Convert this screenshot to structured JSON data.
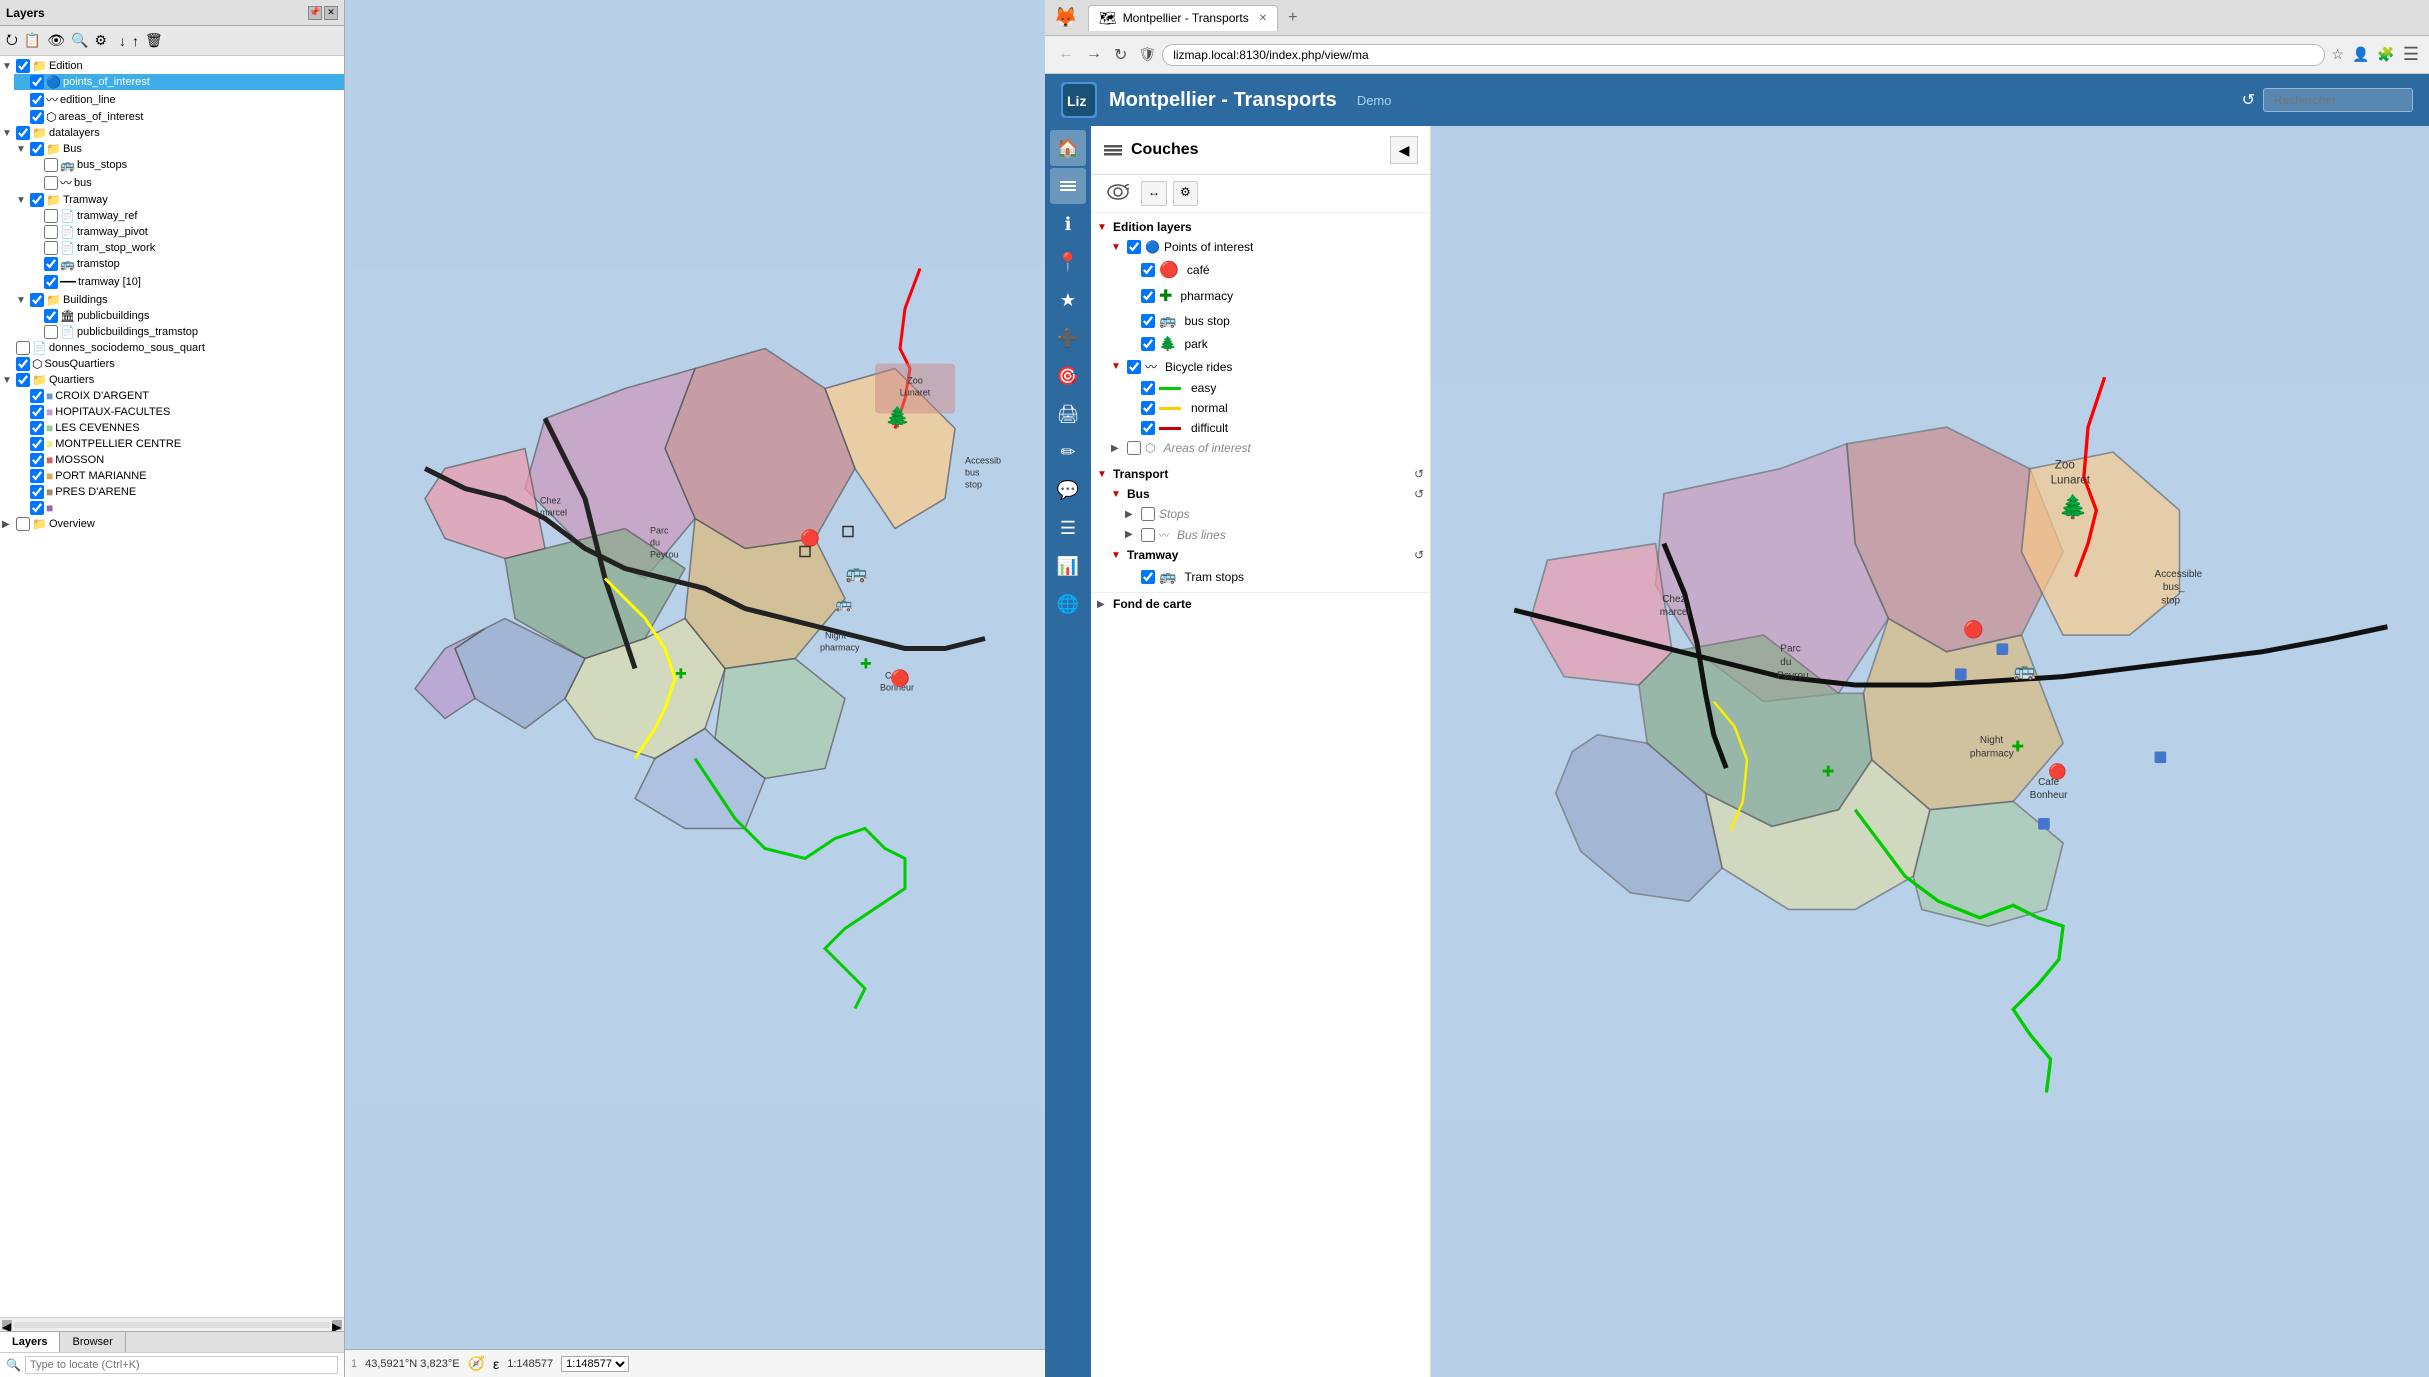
{
  "qgis": {
    "title": "Layers",
    "toolbar_icons": [
      "⭮",
      "📋",
      "👁",
      "🔍",
      "⚙",
      "↓",
      "↑",
      "🗑"
    ],
    "layers": [
      {
        "id": "edition",
        "label": "Edition",
        "level": 0,
        "expand": true,
        "checked": true,
        "icon": "📁",
        "selected": false
      },
      {
        "id": "points_of_interest",
        "label": "points_of_interest",
        "level": 1,
        "expand": false,
        "checked": true,
        "icon": "🔵",
        "selected": true
      },
      {
        "id": "edition_line",
        "label": "edition_line",
        "level": 1,
        "expand": false,
        "checked": true,
        "icon": "〰",
        "selected": false
      },
      {
        "id": "areas_of_interest",
        "label": "areas_of_interest",
        "level": 1,
        "expand": false,
        "checked": true,
        "icon": "⬡",
        "selected": false
      },
      {
        "id": "datalayers",
        "label": "datalayers",
        "level": 0,
        "expand": true,
        "checked": true,
        "icon": "📁",
        "selected": false
      },
      {
        "id": "bus_group",
        "label": "Bus",
        "level": 1,
        "expand": true,
        "checked": true,
        "icon": "📁",
        "selected": false
      },
      {
        "id": "bus_stops",
        "label": "bus_stops",
        "level": 2,
        "expand": false,
        "checked": false,
        "icon": "🚌",
        "selected": false
      },
      {
        "id": "bus",
        "label": "bus",
        "level": 2,
        "expand": false,
        "checked": false,
        "icon": "〰",
        "selected": false
      },
      {
        "id": "tramway_group",
        "label": "Tramway",
        "level": 1,
        "expand": true,
        "checked": true,
        "icon": "📁",
        "selected": false
      },
      {
        "id": "tramway_ref",
        "label": "tramway_ref",
        "level": 2,
        "expand": false,
        "checked": false,
        "icon": "📄",
        "selected": false
      },
      {
        "id": "tramway_pivot",
        "label": "tramway_pivot",
        "level": 2,
        "expand": false,
        "checked": false,
        "icon": "📄",
        "selected": false
      },
      {
        "id": "tram_stop_work",
        "label": "tram_stop_work",
        "level": 2,
        "expand": false,
        "checked": false,
        "icon": "📄",
        "selected": false
      },
      {
        "id": "tramstop",
        "label": "tramstop",
        "level": 2,
        "expand": false,
        "checked": true,
        "icon": "🚌",
        "selected": false
      },
      {
        "id": "tramway",
        "label": "tramway [10]",
        "level": 2,
        "expand": false,
        "checked": true,
        "icon": "—",
        "selected": false
      },
      {
        "id": "buildings_group",
        "label": "Buildings",
        "level": 1,
        "expand": true,
        "checked": true,
        "icon": "📁",
        "selected": false
      },
      {
        "id": "publicbuildings",
        "label": "publicbuildings",
        "level": 2,
        "expand": false,
        "checked": true,
        "icon": "🏛",
        "selected": false
      },
      {
        "id": "publicbuildings_tramstop",
        "label": "publicbuildings_tramstop",
        "level": 2,
        "expand": false,
        "checked": false,
        "icon": "📄",
        "selected": false
      },
      {
        "id": "donnes",
        "label": "donnes_sociodemo_sous_quart",
        "level": 0,
        "expand": false,
        "checked": false,
        "icon": "📄",
        "selected": false
      },
      {
        "id": "sousquartiers",
        "label": "SousQuartiers",
        "level": 0,
        "expand": false,
        "checked": true,
        "icon": "⬡",
        "selected": false
      },
      {
        "id": "quartiers",
        "label": "Quartiers",
        "level": 0,
        "expand": true,
        "checked": true,
        "icon": "📁",
        "selected": false
      },
      {
        "id": "croix",
        "label": "CROIX D'ARGENT",
        "level": 1,
        "expand": false,
        "checked": true,
        "icon": "🟦",
        "selected": false
      },
      {
        "id": "hopitaux",
        "label": "HOPITAUX-FACULTES",
        "level": 1,
        "expand": false,
        "checked": true,
        "icon": "🟪",
        "selected": false
      },
      {
        "id": "cevennes",
        "label": "LES CEVENNES",
        "level": 1,
        "expand": false,
        "checked": true,
        "icon": "🟩",
        "selected": false
      },
      {
        "id": "montpellier_centre",
        "label": "MONTPELLIER CENTRE",
        "level": 1,
        "expand": false,
        "checked": true,
        "icon": "🟨",
        "selected": false
      },
      {
        "id": "mosson",
        "label": "MOSSON",
        "level": 1,
        "expand": false,
        "checked": true,
        "icon": "🟥",
        "selected": false
      },
      {
        "id": "port_marianne",
        "label": "PORT MARIANNE",
        "level": 1,
        "expand": false,
        "checked": true,
        "icon": "🟧",
        "selected": false
      },
      {
        "id": "pres_arene",
        "label": "PRES D'ARENE",
        "level": 1,
        "expand": false,
        "checked": true,
        "icon": "🟫",
        "selected": false
      },
      {
        "id": "pres_arene2",
        "label": "",
        "level": 1,
        "expand": false,
        "checked": true,
        "icon": "🟪",
        "selected": false
      },
      {
        "id": "overview",
        "label": "Overview",
        "level": 0,
        "expand": false,
        "checked": false,
        "icon": "📁",
        "selected": false
      }
    ],
    "bottom_tabs": [
      "Layers",
      "Browser"
    ],
    "active_tab": "Layers",
    "search_placeholder": "Type to locate (Ctrl+K)",
    "coordinates": "43,5921°N 3,823°E",
    "scale": "1:148577"
  },
  "browser": {
    "tabs": [
      {
        "label": "Montpellier - Transports",
        "favicon": "🦊",
        "active": true
      }
    ],
    "new_tab_label": "+",
    "nav": {
      "back": "←",
      "forward": "→",
      "refresh": "↻",
      "shield": "🛡",
      "url": "lizmap.local:8130/index.php/view/ma",
      "star": "☆",
      "profile": "👤"
    }
  },
  "lizmap": {
    "header": {
      "title": "Montpellier - Transports",
      "demo_label": "Demo",
      "search_placeholder": "Rechercher"
    },
    "couches": {
      "title": "Couches",
      "title_icon": "≡",
      "close_icon": "◀",
      "toolbar": {
        "eye_icon": "👁",
        "expand_icon": "↔",
        "settings_icon": "⚙"
      },
      "sections": [
        {
          "id": "edition_layers",
          "label": "Edition layers",
          "collapsed": false,
          "color": "#c00",
          "items": [
            {
              "id": "points_of_interest",
              "label": "Points of interest",
              "checked": true,
              "icon": "🔵",
              "level": 2,
              "children": [
                {
                  "id": "cafe",
                  "label": "café",
                  "checked": true,
                  "icon": "🔴",
                  "level": 3
                },
                {
                  "id": "pharmacy",
                  "label": "pharmacy",
                  "checked": true,
                  "icon": "➕",
                  "color": "green",
                  "level": 3
                },
                {
                  "id": "bus_stop",
                  "label": "bus stop",
                  "checked": true,
                  "icon": "🚌",
                  "level": 3
                },
                {
                  "id": "park",
                  "label": "park",
                  "checked": true,
                  "icon": "🌲",
                  "level": 3
                }
              ]
            },
            {
              "id": "bicycle_rides",
              "label": "Bicycle rides",
              "checked": true,
              "icon": "〰",
              "level": 2,
              "children": [
                {
                  "id": "easy",
                  "label": "easy",
                  "checked": true,
                  "color_line": "#00cc00",
                  "level": 3
                },
                {
                  "id": "normal",
                  "label": "normal",
                  "checked": true,
                  "color_line": "#ffff00",
                  "level": 3
                },
                {
                  "id": "difficult",
                  "label": "difficult",
                  "checked": true,
                  "color_line": "#cc0000",
                  "level": 3
                }
              ]
            },
            {
              "id": "areas_of_interest",
              "label": "Areas of interest",
              "checked": false,
              "italic": true,
              "icon": "⬡",
              "level": 2
            }
          ]
        },
        {
          "id": "transport",
          "label": "Transport",
          "collapsed": false,
          "color": "#c00",
          "items": [
            {
              "id": "bus_transport",
              "label": "Bus",
              "checked": false,
              "level": 2,
              "has_refresh": true,
              "children": [
                {
                  "id": "stops",
                  "label": "Stops",
                  "checked": false,
                  "italic": true,
                  "level": 3
                },
                {
                  "id": "bus_lines",
                  "label": "Bus lines",
                  "checked": false,
                  "italic": true,
                  "icon": "〰",
                  "level": 3
                }
              ]
            },
            {
              "id": "tramway_transport",
              "label": "Tramway",
              "checked": false,
              "level": 2,
              "has_refresh": true,
              "children": [
                {
                  "id": "tram_stops",
                  "label": "Tram stops",
                  "checked": true,
                  "icon": "🚌",
                  "level": 3
                }
              ]
            }
          ]
        }
      ]
    },
    "toolbar_buttons": [
      {
        "icon": "🏠",
        "name": "home"
      },
      {
        "icon": "≡",
        "name": "layers"
      },
      {
        "icon": "ℹ",
        "name": "info"
      },
      {
        "icon": "📍",
        "name": "locate"
      },
      {
        "icon": "★",
        "name": "favorites"
      },
      {
        "icon": "➕",
        "name": "add"
      },
      {
        "icon": "🎯",
        "name": "target"
      },
      {
        "icon": "🖨",
        "name": "print"
      },
      {
        "icon": "✏",
        "name": "edit"
      },
      {
        "icon": "💬",
        "name": "measure"
      },
      {
        "icon": "☰",
        "name": "list"
      },
      {
        "icon": "📊",
        "name": "chart"
      },
      {
        "icon": "🌐",
        "name": "globe"
      }
    ]
  }
}
